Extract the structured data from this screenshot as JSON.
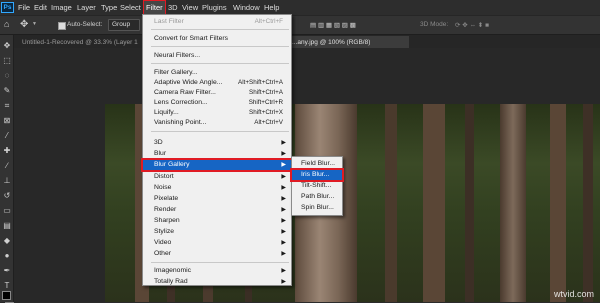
{
  "app": {
    "logo_text": "Ps"
  },
  "menubar": {
    "items": [
      "File",
      "Edit",
      "Image",
      "Layer",
      "Type",
      "Select",
      "Filter",
      "3D",
      "View",
      "Plugins",
      "Window",
      "Help"
    ]
  },
  "options_bar": {
    "auto_select_label": "Auto-Select:",
    "auto_select_value": "Group",
    "mode_3d_label": "3D Mode:"
  },
  "tabs": [
    {
      "label": "Untitled-1-Recovered @ 33.3% (Layer 1"
    },
    {
      "label": "...any.jpg @ 100% (RGB/8)"
    }
  ],
  "filter_menu": {
    "last_filter": {
      "label": "Last Filter",
      "shortcut": "Alt+Ctrl+F"
    },
    "convert_smart": "Convert for Smart Filters",
    "neural": "Neural Filters...",
    "gallery_group": [
      {
        "label": "Filter Gallery...",
        "shortcut": ""
      },
      {
        "label": "Adaptive Wide Angle...",
        "shortcut": "Alt+Shift+Ctrl+A"
      },
      {
        "label": "Camera Raw Filter...",
        "shortcut": "Shift+Ctrl+A"
      },
      {
        "label": "Lens Correction...",
        "shortcut": "Shift+Ctrl+R"
      },
      {
        "label": "Liquify...",
        "shortcut": "Shift+Ctrl+X"
      },
      {
        "label": "Vanishing Point...",
        "shortcut": "Alt+Ctrl+V"
      }
    ],
    "submenus": [
      "3D",
      "Blur",
      "Blur Gallery",
      "Distort",
      "Noise",
      "Pixelate",
      "Render",
      "Sharpen",
      "Stylize",
      "Video",
      "Other"
    ],
    "plugins": [
      "Imagenomic",
      "Totally Rad"
    ]
  },
  "blur_gallery_submenu": [
    "Field Blur...",
    "Iris Blur...",
    "Tilt-Shift...",
    "Path Blur...",
    "Spin Blur..."
  ],
  "watermark": "wtvid.com",
  "colors": {
    "highlight": "#1665c4",
    "annotation_red": "#e01b24",
    "menu_bg": "#f0f0f0"
  }
}
